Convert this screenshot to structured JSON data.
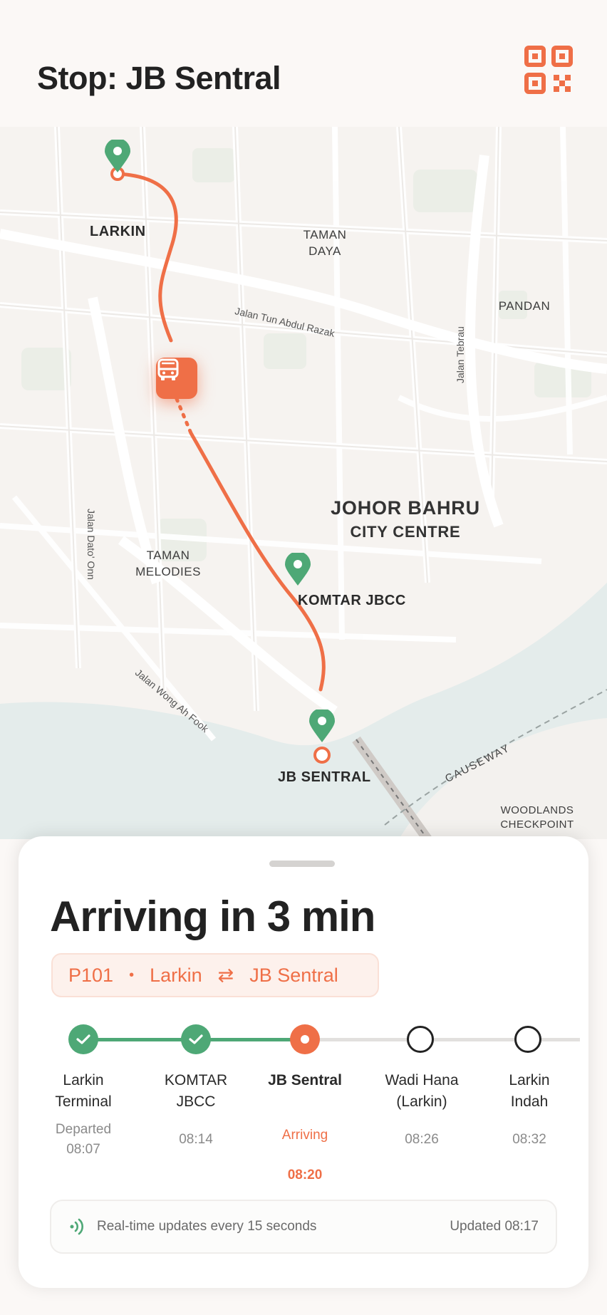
{
  "header": {
    "title": "Stop: JB Sentral",
    "qr_icon": "qr-code-icon"
  },
  "map": {
    "districts": [
      {
        "name": "Taman\nDaya"
      },
      {
        "name": "Pandan"
      },
      {
        "name": "Taman\nMelodies"
      },
      {
        "name": "Woodlands\nCheckpoint"
      }
    ],
    "city": {
      "line1": "Johor Bahru",
      "line2": "City Centre"
    },
    "streets": {
      "tun_abdul_razak": "Jalan Tun Abdul Razak",
      "tebrau": "Jalan Tebrau",
      "dato_onn": "Jalan Dato' Onn",
      "wong_ah_fook": "Jalan Wong Ah Fook",
      "causeway": "CAUSEWAY"
    },
    "stops": {
      "larkin": "LARKIN",
      "komtar": "KOMTAR JBCC",
      "jb_sentral": "JB SENTRAL"
    },
    "route_color": "#ef6f47",
    "pin_color": "#4ea876"
  },
  "sheet": {
    "arrival_text": "Arriving in 3 min",
    "route": {
      "code": "P101",
      "separator": "•",
      "from": "Larkin",
      "swap_symbol": "⇄",
      "to": "JB Sentral"
    },
    "stops": [
      {
        "name": "Larkin\nTerminal",
        "status": "Departed\n08:07",
        "state": "done"
      },
      {
        "name": "KOMTAR\nJBCC",
        "status": "08:14",
        "state": "done"
      },
      {
        "name": "JB Sentral",
        "status_label": "Arriving",
        "time": "08:20",
        "state": "current"
      },
      {
        "name": "Wadi Hana\n(Larkin)",
        "status": "08:26",
        "state": "future"
      },
      {
        "name": "Larkin\nIndah",
        "status": "08:32",
        "state": "future"
      }
    ],
    "info": {
      "text": "Real-time updates every 15 seconds",
      "updated": "Updated 08:17"
    }
  }
}
